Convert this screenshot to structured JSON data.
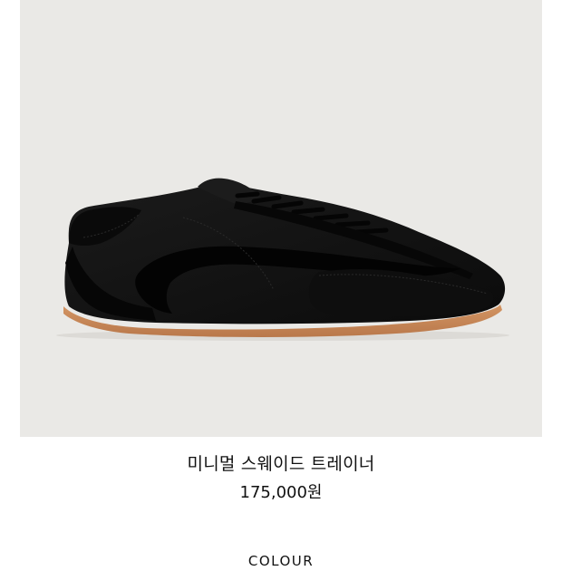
{
  "product": {
    "image_subject": "black-suede-sneaker",
    "title": "미니멀 스웨이드 트레이너",
    "price": "175,000원",
    "colour_label": "COLOUR"
  },
  "colors": {
    "image_background": "#eae9e6",
    "shoe_suede": "#121212",
    "shoe_leather": "#050505",
    "sole_gum": "#c98a5a"
  }
}
